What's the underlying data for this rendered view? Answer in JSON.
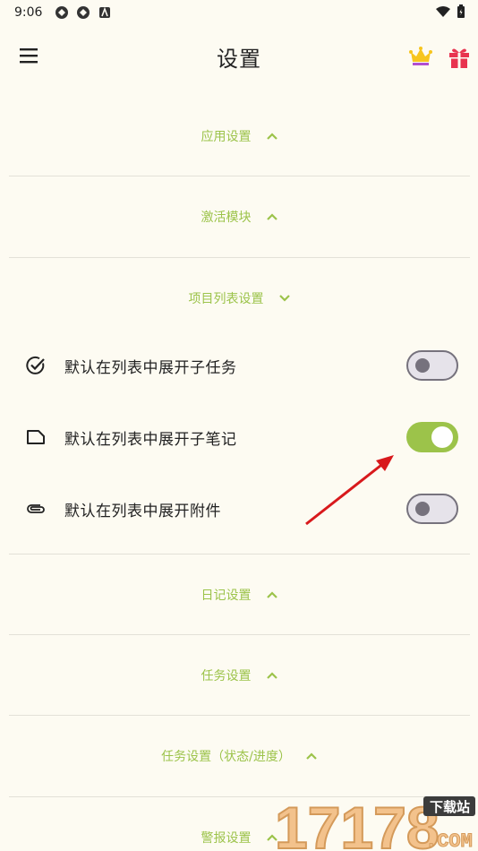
{
  "status_bar": {
    "time": "9:06"
  },
  "app_bar": {
    "title": "设置"
  },
  "sections_top": [
    {
      "label": "应用设置",
      "expanded": true
    },
    {
      "label": "激活模块",
      "expanded": true
    }
  ],
  "project_list": {
    "label": "项目列表设置",
    "items": [
      {
        "icon": "check-circle-icon",
        "label": "默认在列表中展开子任务",
        "enabled": false
      },
      {
        "icon": "note-icon",
        "label": "默认在列表中展开子笔记",
        "enabled": true
      },
      {
        "icon": "paperclip-icon",
        "label": "默认在列表中展开附件",
        "enabled": false
      }
    ]
  },
  "sections_bottom": [
    {
      "label": "日记设置"
    },
    {
      "label": "任务设置"
    },
    {
      "label": "任务设置（状态/进度）"
    },
    {
      "label": "警报设置"
    }
  ],
  "watermark": {
    "digits": "17178",
    "badge": "下载站",
    "suffix": ".COM"
  },
  "colors": {
    "accent": "#9cc34a",
    "background": "#fdfbf2",
    "arrow": "#d8191c"
  }
}
